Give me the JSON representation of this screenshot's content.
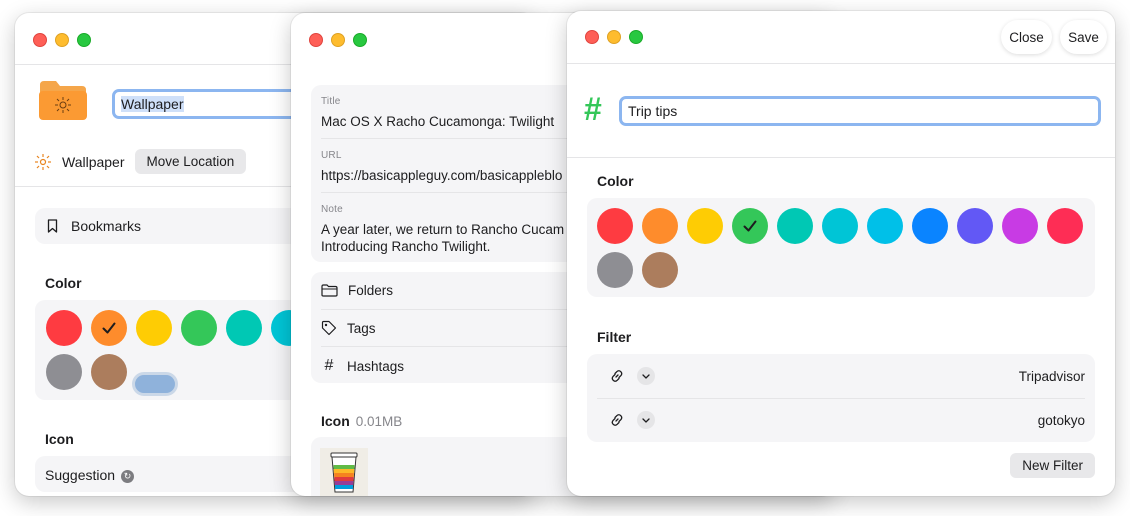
{
  "window1": {
    "folder_name": "Wallpaper",
    "location_name": "Wallpaper",
    "move_location_label": "Move Location",
    "bookmarks_label": "Bookmarks",
    "color_section": "Color",
    "icon_section": "Icon",
    "suggestion_label": "Suggestion",
    "colors": [
      "#fe3b41",
      "#fe8c2c",
      "#fecc04",
      "#34c759",
      "#00c8b4",
      "#00c5d6",
      "#8e8e93",
      "#ac7d5d"
    ],
    "selected_color": "#fe8c2c"
  },
  "window2": {
    "title_label": "Title",
    "title_value": "Mac OS X Racho Cucamonga: Twilight",
    "url_label": "URL",
    "url_value": "https://basicappleguy.com/basicappleblo",
    "note_label": "Note",
    "note_line1": "A year later, we return to Rancho Cucam",
    "note_line2": "Introducing Rancho Twilight.",
    "folders_label": "Folders",
    "tags_label": "Tags",
    "hashtags_label": "Hashtags",
    "icon_label": "Icon",
    "icon_size": "0.01MB"
  },
  "window3": {
    "close_label": "Close",
    "save_label": "Save",
    "title_value": "Trip tips",
    "color_section": "Color",
    "filter_section": "Filter",
    "colors": [
      "#fe3b41",
      "#fe8c2c",
      "#fecc04",
      "#34c759",
      "#00c8b4",
      "#00c5d6",
      "#00c0e8",
      "#0a84ff",
      "#6258f5",
      "#c83be4",
      "#fe2d55",
      "#8e8e93",
      "#ac7d5d"
    ],
    "selected_color": "#34c759",
    "filters": [
      {
        "value": "Tripadvisor"
      },
      {
        "value": "gotokyo"
      }
    ],
    "new_filter_label": "New Filter"
  }
}
